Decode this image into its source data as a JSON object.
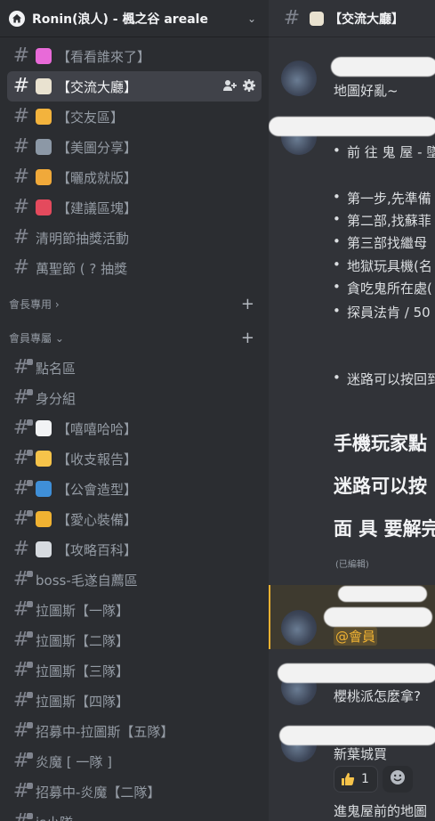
{
  "server": {
    "name": "Ronin(浪人) - 楓之谷 areale"
  },
  "channels_top": [
    {
      "name": "【看看誰來了】",
      "emoji": "party-popper",
      "emoji_color": "#e86ad8"
    },
    {
      "name": "【交流大廳】",
      "emoji": "memo",
      "emoji_color": "#e9e2d0",
      "active": true
    },
    {
      "name": "【交友區】",
      "emoji": "handshake",
      "emoji_color": "#f3b33d"
    },
    {
      "name": "【美圖分享】",
      "emoji": "camera",
      "emoji_color": "#8c98a6"
    },
    {
      "name": "【曬成就版】",
      "emoji": "medal",
      "emoji_color": "#f0a93a"
    },
    {
      "name": "【建議區塊】",
      "emoji": "inbox-tray",
      "emoji_color": "#e44a5d"
    },
    {
      "name": "清明節抽獎活動",
      "emoji": ""
    },
    {
      "name": "萬聖節 ( ? 抽獎",
      "emoji": ""
    }
  ],
  "categories": {
    "cat1": {
      "label": "會長專用"
    },
    "cat2": {
      "label": "會員專屬"
    }
  },
  "channels_members": [
    {
      "name": "點名區",
      "emoji": ""
    },
    {
      "name": "身分組",
      "emoji": ""
    },
    {
      "name": "【嘻嘻哈哈】",
      "emoji": "speech-balloon",
      "emoji_color": "#f2f3f5"
    },
    {
      "name": "【收支報告】",
      "emoji": "money-mouth-face",
      "emoji_color": "#f6c34a"
    },
    {
      "name": "【公會造型】",
      "emoji": "t-shirt",
      "emoji_color": "#3f8fd8"
    },
    {
      "name": "【愛心裝備】",
      "emoji": "performing-arts",
      "emoji_color": "#f0b232"
    },
    {
      "name": "【攻略百科】",
      "emoji": "open-book",
      "emoji_color": "#d7dbe0",
      "forum": true
    },
    {
      "name": "boss-毛遂自薦區",
      "emoji": ""
    },
    {
      "name": "拉圖斯【一隊】",
      "emoji": ""
    },
    {
      "name": "拉圖斯【二隊】",
      "emoji": ""
    },
    {
      "name": "拉圖斯【三隊】",
      "emoji": ""
    },
    {
      "name": "拉圖斯【四隊】",
      "emoji": ""
    },
    {
      "name": "招募中-拉圖斯【五隊】",
      "emoji": ""
    },
    {
      "name": "炎魔 [ 一隊 ]",
      "emoji": ""
    },
    {
      "name": "招募中-炎魔【二隊】",
      "emoji": ""
    },
    {
      "name": "is小隊",
      "emoji": ""
    }
  ],
  "main": {
    "channel_title": "【交流大廳】",
    "msg1_text": "地圖好亂~",
    "msg2_bullet1": "前 往 鬼 屋 - 墜",
    "msg2_bullets": [
      "第一步,先準備",
      "第二部,找蘇菲",
      "第三部找繼母",
      "地獄玩具機(名",
      "貪吃鬼所在處(",
      "探員法肯 / 50"
    ],
    "msg2_bullet_last": "迷路可以按回到",
    "big1": "手機玩家點",
    "big2": "迷路可以按",
    "big3": "面 具 要解完",
    "edited": "(已編輯)",
    "mention": "@會員",
    "msg4_text": "櫻桃派怎麼拿?",
    "msg5_text": "新葉城買",
    "reaction_count": "1",
    "msg6_text": "進鬼屋前的地圖"
  }
}
